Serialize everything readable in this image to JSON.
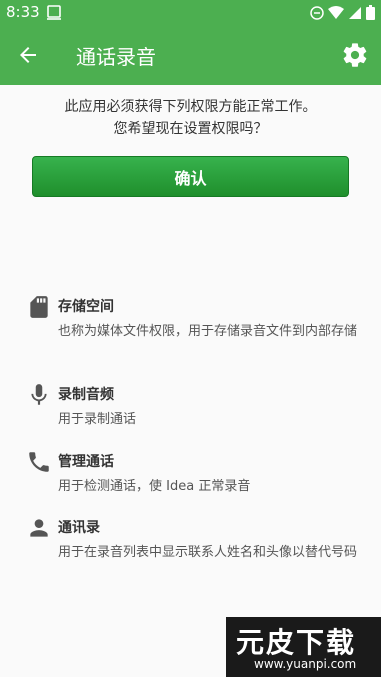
{
  "status_bar": {
    "time": "8:33"
  },
  "app_bar": {
    "title": "通话录音"
  },
  "prompt": {
    "line1": "此应用必须获得下列权限方能正常工作。",
    "line2": "您希望现在设置权限吗？"
  },
  "confirm_label": "确认",
  "permissions": [
    {
      "icon": "sd-card-icon",
      "title": "存储空间",
      "desc": "也称为媒体文件权限，用于存储录音文件到内部存储"
    },
    {
      "icon": "microphone-icon",
      "title": "录制音频",
      "desc": "用于录制通话"
    },
    {
      "icon": "phone-icon",
      "title": "管理通话",
      "desc": "用于检测通话，使 Idea 正常录音"
    },
    {
      "icon": "person-icon",
      "title": "通讯录",
      "desc": "用于在录音列表中显示联系人姓名和头像以替代号码"
    }
  ],
  "watermark": {
    "main": "元皮下载",
    "url": "www.yuanpi.com"
  },
  "colors": {
    "primary": "#4caf50",
    "button": "#2aa13c"
  }
}
